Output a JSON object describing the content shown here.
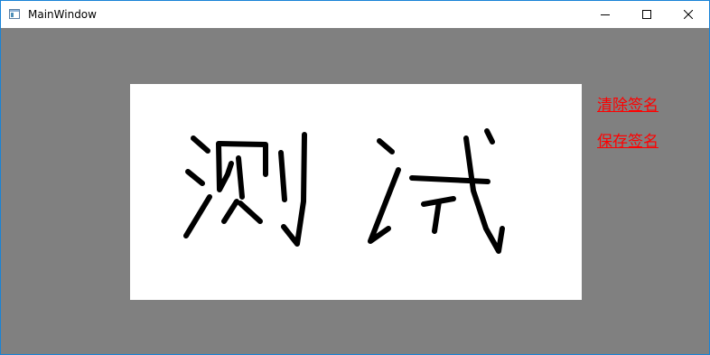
{
  "window": {
    "title": "MainWindow",
    "accent_border": "#1883d7",
    "background": "#808080"
  },
  "titlebar": {
    "icons": {
      "app": "app-window-icon",
      "minimize": "minimize-icon",
      "maximize": "maximize-icon",
      "close": "close-icon"
    }
  },
  "signature_canvas": {
    "background": "#ffffff",
    "stroke_color": "#000000"
  },
  "actions": {
    "clear_label": "清除签名",
    "save_label": "保存签名",
    "link_color": "#ff0000"
  }
}
